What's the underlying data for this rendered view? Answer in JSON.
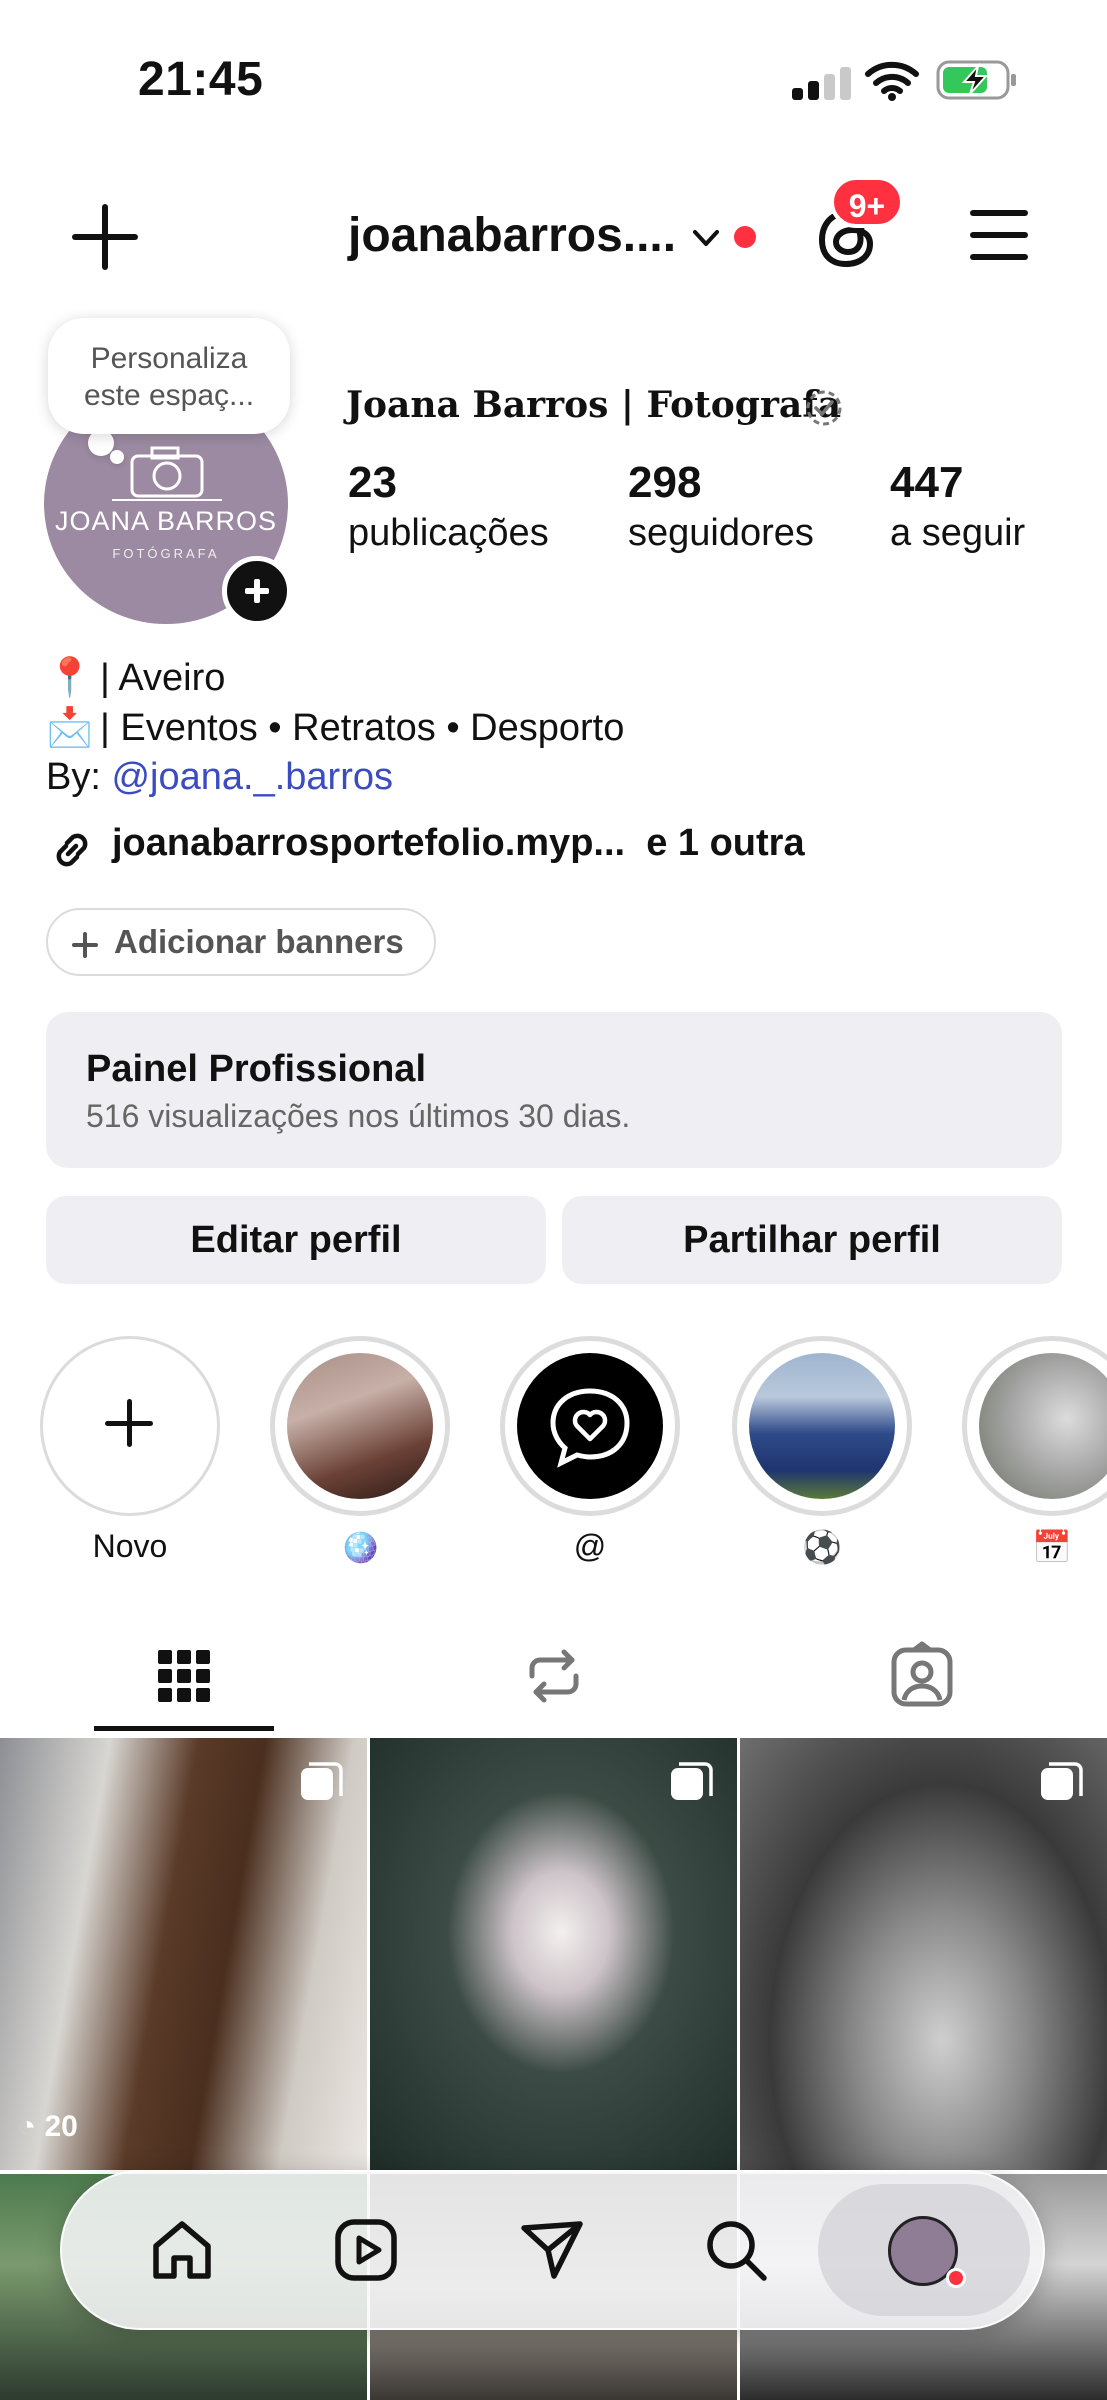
{
  "status_bar": {
    "time": "21:45"
  },
  "header": {
    "username": "joanabarros....",
    "notifications_badge": "9+"
  },
  "tooltip": {
    "text_line1": "Personaliza",
    "text_line2": "este espaç..."
  },
  "avatar": {
    "logo_name": "JOANA BARROS",
    "logo_sub": "FOTÓGRAFA"
  },
  "profile": {
    "display_name": "Joana Barros | Fotografa",
    "stats": [
      {
        "value": "23",
        "label": "publicações"
      },
      {
        "value": "298",
        "label": "seguidores"
      },
      {
        "value": "447",
        "label": "a seguir"
      }
    ]
  },
  "bio": {
    "line1_emoji": "📍",
    "line1_text": "| Aveiro",
    "line2_emoji": "📩",
    "line2_text": "| Eventos • Retratos • Desporto",
    "line3_prefix": "By: ",
    "line3_mention": "@joana._.barros",
    "link_text": "joanabarrosportefolio.myp...",
    "link_more": "e 1 outra"
  },
  "banner_button": "Adicionar banners",
  "dashboard": {
    "title": "Painel Profissional",
    "subtitle": "516 visualizações nos últimos 30 dias."
  },
  "buttons": {
    "edit": "Editar perfil",
    "share": "Partilhar perfil"
  },
  "highlights": [
    {
      "label": "Novo"
    },
    {
      "label": "🪩"
    },
    {
      "label": "@"
    },
    {
      "label": "⚽"
    },
    {
      "label": "📅"
    }
  ],
  "posts": [
    {
      "views": "20"
    }
  ],
  "colors": {
    "accent_red": "#ff3040",
    "mention_blue": "#3b4cc0",
    "panel_gray": "#efeff3"
  }
}
